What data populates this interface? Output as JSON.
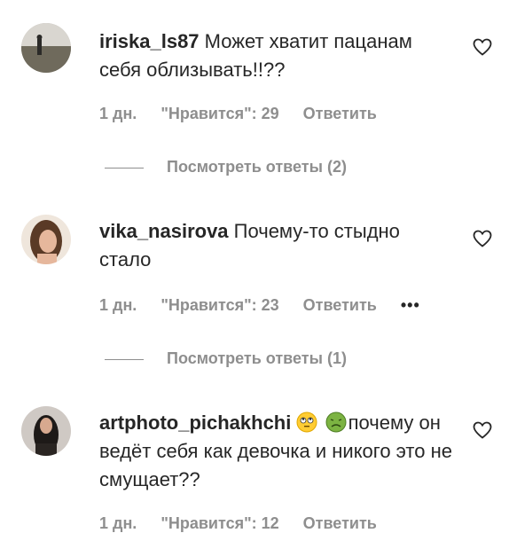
{
  "comments": [
    {
      "username": "iriska_ls87",
      "text": "Может хватит пацанам себя облизывать!!??",
      "time": "1 дн.",
      "likes": "\"Нравится\": 29",
      "reply": "Ответить",
      "view_replies": "Посмотреть ответы (2)"
    },
    {
      "username": "vika_nasirova",
      "text": "Почему-то стыдно стало",
      "time": "1 дн.",
      "likes": "\"Нравится\": 23",
      "reply": "Ответить",
      "more": "•••",
      "view_replies": "Посмотреть ответы (1)"
    },
    {
      "username": "artphoto_pichakhchi",
      "emoji_1": "face-with-rolling-eyes",
      "emoji_2": "nauseated-face",
      "text": "почему он ведёт себя как девочка и никого это не смущает??",
      "time": "1 дн.",
      "likes": "\"Нравится\": 12",
      "reply": "Ответить"
    }
  ],
  "colors": {
    "text": "#262626",
    "secondary": "#8e8e8e",
    "background": "#ffffff"
  }
}
